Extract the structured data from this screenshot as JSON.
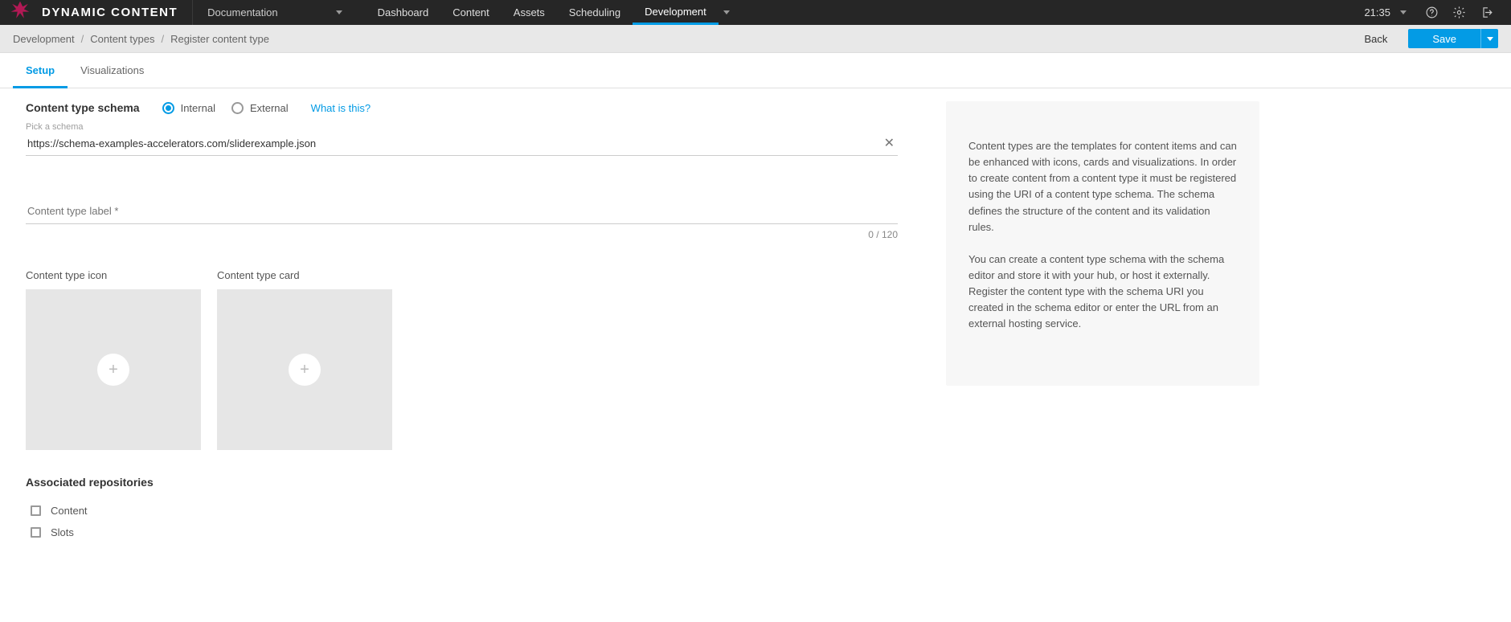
{
  "brand": {
    "title": "DYNAMIC CONTENT"
  },
  "env_picker": {
    "label": "Documentation"
  },
  "nav": {
    "items": [
      {
        "label": "Dashboard",
        "active": false
      },
      {
        "label": "Content",
        "active": false
      },
      {
        "label": "Assets",
        "active": false
      },
      {
        "label": "Scheduling",
        "active": false
      },
      {
        "label": "Development",
        "active": true
      }
    ]
  },
  "clock": {
    "time": "21:35"
  },
  "breadcrumbs": {
    "segments": [
      "Development",
      "Content types",
      "Register content type"
    ]
  },
  "actions": {
    "back": "Back",
    "save": "Save"
  },
  "tabs": [
    {
      "label": "Setup",
      "active": true
    },
    {
      "label": "Visualizations",
      "active": false
    }
  ],
  "schema": {
    "title": "Content type schema",
    "radios": {
      "internal": "Internal",
      "external": "External",
      "selected": "internal"
    },
    "help_link": "What is this?",
    "pick_label": "Pick a schema",
    "value": "https://schema-examples-accelerators.com/sliderexample.json"
  },
  "label_field": {
    "placeholder": "Content type label *",
    "counter": "0 / 120"
  },
  "uploads": {
    "icon_title": "Content type icon",
    "card_title": "Content type card"
  },
  "repos": {
    "title": "Associated repositories",
    "items": [
      "Content",
      "Slots"
    ]
  },
  "info": {
    "p1": "Content types are the templates for content items and can be enhanced with icons, cards and visualizations. In order to create content from a content type it must be registered using the URI of a content type schema. The schema defines the structure of the content and its validation rules.",
    "p2": "You can create a content type schema with the schema editor and store it with your hub, or host it externally. Register the content type with the schema URI you created in the schema editor or enter the URL from an external hosting service."
  }
}
